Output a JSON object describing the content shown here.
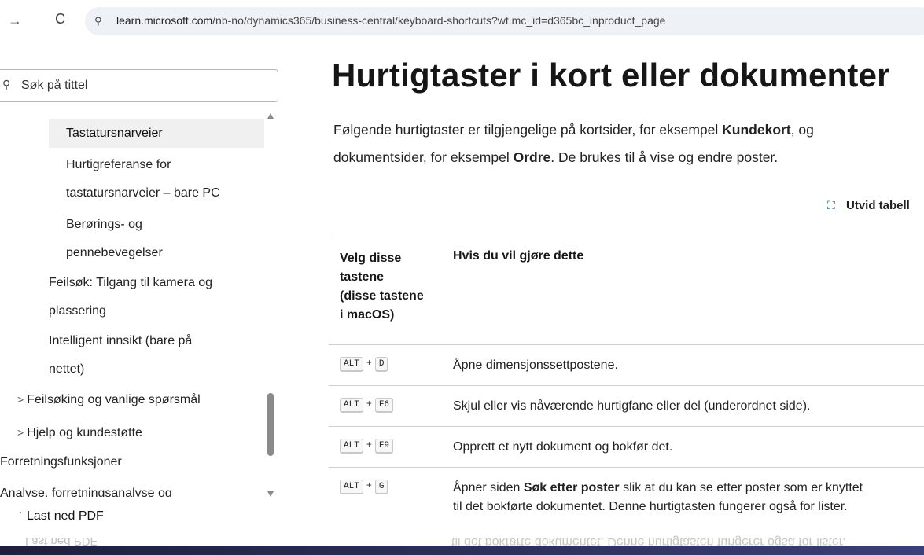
{
  "browser": {
    "url_host": "learn.microsoft.com",
    "url_path": "/nb-no/dynamics365/business-central/keyboard-shortcuts?wt.mc_id=d365bc_inproduct_page"
  },
  "sidebar": {
    "search_placeholder": "Søk på tittel",
    "items": [
      {
        "label": "Tastatursnarveier"
      },
      {
        "label": "Hurtigreferanse for"
      },
      {
        "label": "tastatursnarveier – bare PC"
      },
      {
        "label": "Berørings- og"
      },
      {
        "label": "pennebevegelser"
      },
      {
        "label": "Feilsøk: Tilgang til kamera og"
      },
      {
        "label": "plassering"
      },
      {
        "label": "Intelligent innsikt (bare på"
      },
      {
        "label": "nettet)"
      },
      {
        "label": "Feilsøking og vanlige spørsmål"
      },
      {
        "label": "Hjelp og kundestøtte"
      },
      {
        "label": "Forretningsfunksjoner"
      },
      {
        "label": "Analyse, forretningsanalyse og"
      }
    ],
    "download_pdf": "Last ned PDF"
  },
  "main": {
    "title": "Hurtigtaster i kort eller dokumenter",
    "intro": {
      "p1_a": "Følgende hurtigtaster er tilgjengelige på kortsider, for eksempel ",
      "p1_b": "Kundekort",
      "p1_c": ", og",
      "p2_a": "dokumentsider, for eksempel ",
      "p2_b": "Ordre",
      "p2_c": ". De brukes til å vise og endre poster."
    },
    "expand_table": "Utvid tabell",
    "table": {
      "header_col1": [
        "Velg disse",
        "tastene",
        "(disse tastene",
        "i macOS)"
      ],
      "header_col2": "Hvis du vil gjøre dette",
      "rows": [
        {
          "key1": "ALT",
          "plus": "+",
          "key2": "D",
          "desc": "Åpne dimensjonssettpostene."
        },
        {
          "key1": "ALT",
          "plus": "+",
          "key2": "F6",
          "desc": "Skjul eller vis nåværende hurtigfane eller del (underordnet side)."
        },
        {
          "key1": "ALT",
          "plus": "+",
          "key2": "F9",
          "desc": "Opprett et nytt dokument og bokfør det."
        },
        {
          "key1": "ALT",
          "plus": "+",
          "key2": "G",
          "desc_a": "Åpner siden ",
          "desc_b": "Søk etter poster",
          "desc_c": " slik at du kan se etter poster som er knyttet",
          "desc_d": "til det bokførte dokumentet. Denne hurtigtasten fungerer også for lister."
        }
      ]
    }
  },
  "reflections": {
    "pdf": "Last ned PDF",
    "text": "til det bokførte dokumentet. Denne hurtigtasten fungerer også for lister."
  }
}
